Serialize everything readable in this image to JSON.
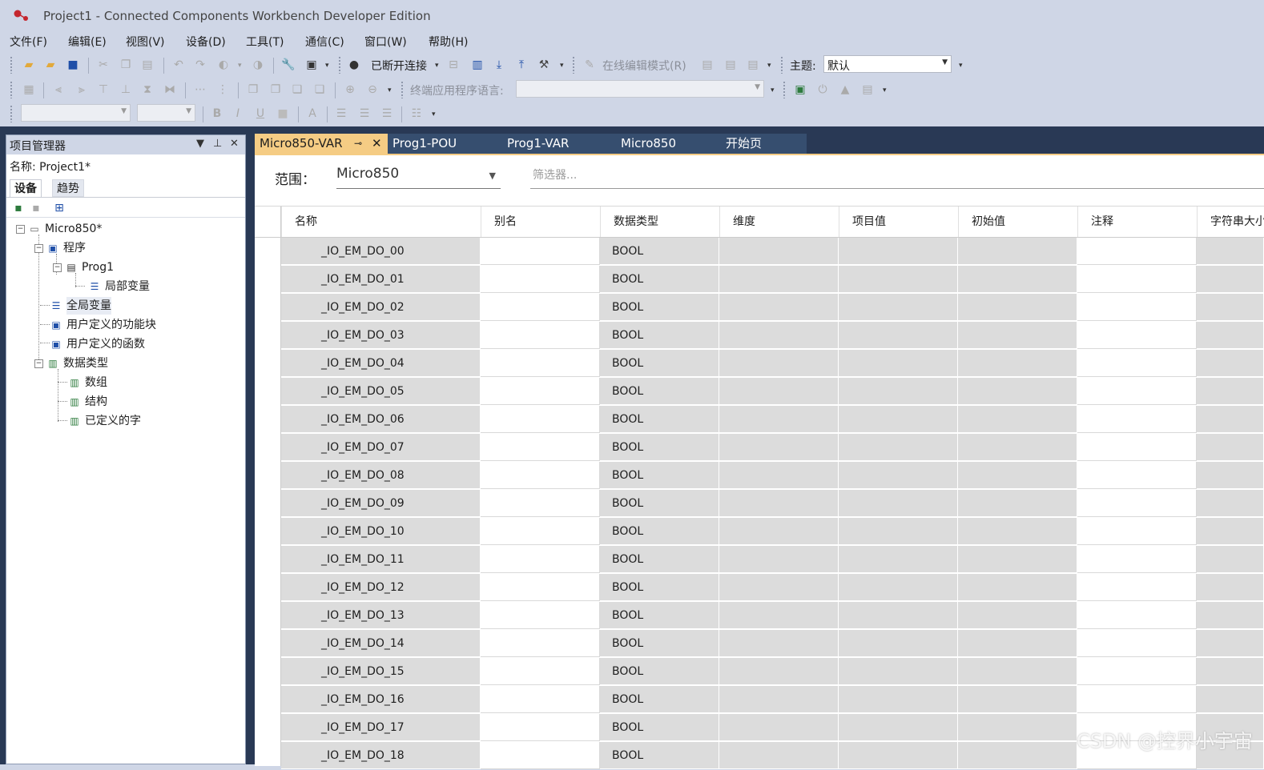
{
  "window": {
    "title": "Project1 - Connected Components Workbench Developer Edition"
  },
  "menu": [
    "文件(F)",
    "编辑(E)",
    "视图(V)",
    "设备(D)",
    "工具(T)",
    "通信(C)",
    "窗口(W)",
    "帮助(H)"
  ],
  "toolbar": {
    "connect_label": "已断开连接",
    "online_edit_label": "在线编辑模式(R)",
    "theme_label": "主题:",
    "theme_value": "默认",
    "terminal_lang_label": "终端应用程序语言:"
  },
  "project_panel": {
    "title": "项目管理器",
    "name_label": "名称:",
    "name_value": "Project1*",
    "tabs": [
      "设备",
      "趋势"
    ],
    "tree": {
      "root": "Micro850*",
      "program": "程序",
      "prog1": "Prog1",
      "local_vars": "局部变量",
      "global_vars": "全局变量",
      "udfb": "用户定义的功能块",
      "udf": "用户定义的函数",
      "datatypes": "数据类型",
      "arrays": "数组",
      "structs": "结构",
      "defined_words": "已定义的字"
    }
  },
  "doc_tabs": [
    "Micro850-VAR",
    "Prog1-POU",
    "Prog1-VAR",
    "Micro850",
    "开始页"
  ],
  "scope": {
    "label": "范围：",
    "value": "Micro850"
  },
  "filter": {
    "placeholder": "筛选器..."
  },
  "grid": {
    "columns": [
      "名称",
      "别名",
      "数据类型",
      "维度",
      "项目值",
      "初始值",
      "注释",
      "字符串大小"
    ],
    "rows": [
      {
        "name": "_IO_EM_DO_00",
        "type": "BOOL"
      },
      {
        "name": "_IO_EM_DO_01",
        "type": "BOOL"
      },
      {
        "name": "_IO_EM_DO_02",
        "type": "BOOL"
      },
      {
        "name": "_IO_EM_DO_03",
        "type": "BOOL"
      },
      {
        "name": "_IO_EM_DO_04",
        "type": "BOOL"
      },
      {
        "name": "_IO_EM_DO_05",
        "type": "BOOL"
      },
      {
        "name": "_IO_EM_DO_06",
        "type": "BOOL"
      },
      {
        "name": "_IO_EM_DO_07",
        "type": "BOOL"
      },
      {
        "name": "_IO_EM_DO_08",
        "type": "BOOL"
      },
      {
        "name": "_IO_EM_DO_09",
        "type": "BOOL"
      },
      {
        "name": "_IO_EM_DO_10",
        "type": "BOOL"
      },
      {
        "name": "_IO_EM_DO_11",
        "type": "BOOL"
      },
      {
        "name": "_IO_EM_DO_12",
        "type": "BOOL"
      },
      {
        "name": "_IO_EM_DO_13",
        "type": "BOOL"
      },
      {
        "name": "_IO_EM_DO_14",
        "type": "BOOL"
      },
      {
        "name": "_IO_EM_DO_15",
        "type": "BOOL"
      },
      {
        "name": "_IO_EM_DO_16",
        "type": "BOOL"
      },
      {
        "name": "_IO_EM_DO_17",
        "type": "BOOL"
      },
      {
        "name": "_IO_EM_DO_18",
        "type": "BOOL"
      }
    ]
  },
  "watermark": "CSDN @控界小宇宙"
}
